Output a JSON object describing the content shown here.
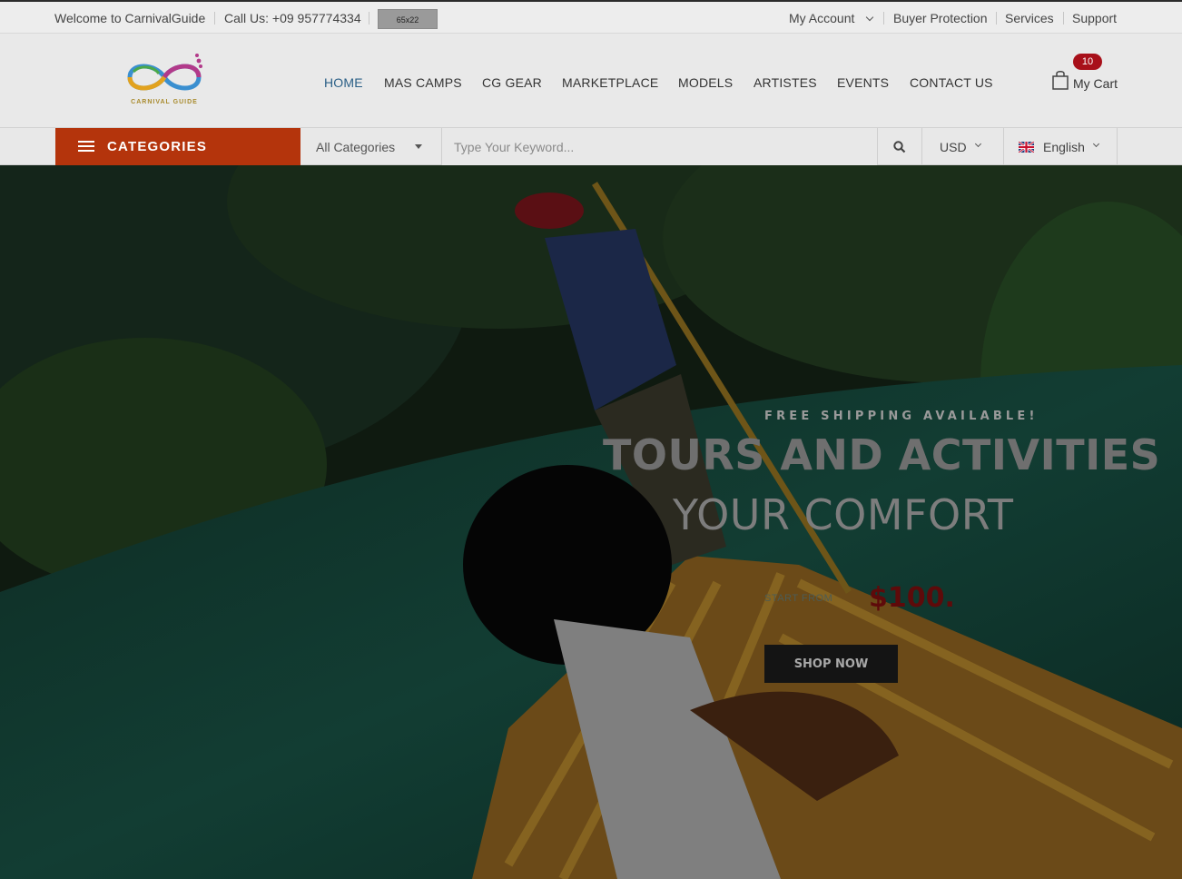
{
  "topbar": {
    "welcome": "Welcome to CarnivalGuide",
    "phone": "Call Us: +09 957774334",
    "placeholder_badge": "65x22",
    "account": "My Account",
    "buyer_protection": "Buyer Protection",
    "services": "Services",
    "support": "Support"
  },
  "header": {
    "logo_text": "CARNIVAL GUIDE",
    "nav": [
      "HOME",
      "MAS CAMPS",
      "CG GEAR",
      "MARKETPLACE",
      "MODELS",
      "ARTISTES",
      "EVENTS",
      "CONTACT US"
    ],
    "active_nav": "HOME",
    "cart_label": "My Cart",
    "cart_count": "10"
  },
  "search": {
    "categories_label": "CATEGORIES",
    "category_select": "All Categories",
    "placeholder": "Type Your Keyword...",
    "currency": "USD",
    "language": "English"
  },
  "hero": {
    "kicker": "FREE SHIPPING AVAILABLE!",
    "headline": "TOURS AND ACTIVITIES",
    "subline": "YOUR COMFORT",
    "start_from": "START FROM",
    "price": "$100.",
    "cta": "SHOP NOW"
  },
  "colors": {
    "accent": "#b4340c",
    "active_link": "#2a5f86",
    "badge": "#a8101a",
    "price": "#5e0a0a"
  },
  "icons": [
    "chevron-down-icon",
    "menu-icon",
    "search-icon",
    "cart-icon",
    "uk-flag-icon",
    "logo-infinity"
  ]
}
